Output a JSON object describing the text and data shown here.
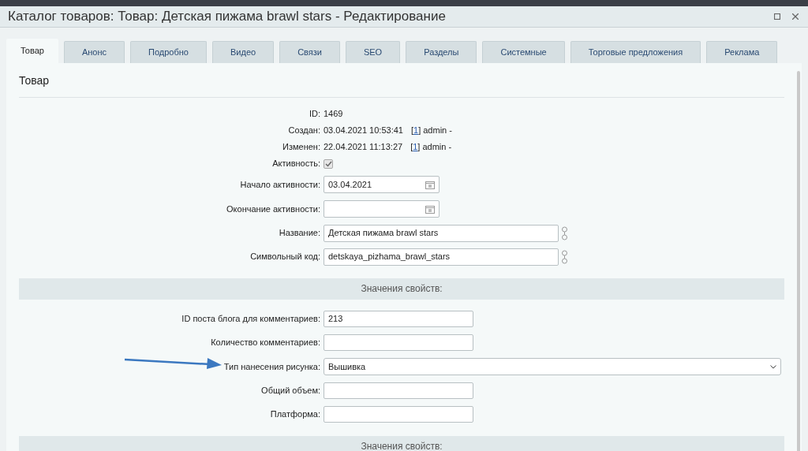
{
  "window": {
    "title": "Каталог товаров: Товар: Детская пижама brawl stars - Редактирование"
  },
  "tabs": [
    {
      "label": "Товар",
      "selected": true
    },
    {
      "label": "Анонс",
      "selected": false
    },
    {
      "label": "Подробно",
      "selected": false
    },
    {
      "label": "Видео",
      "selected": false
    },
    {
      "label": "Связи",
      "selected": false
    },
    {
      "label": "SEO",
      "selected": false
    },
    {
      "label": "Разделы",
      "selected": false
    },
    {
      "label": "Системные",
      "selected": false
    },
    {
      "label": "Торговые предложения",
      "selected": false
    },
    {
      "label": "Реклама",
      "selected": false
    }
  ],
  "section_title": "Товар",
  "rows": [
    {
      "kind": "text",
      "label": "ID:",
      "value": "1469"
    },
    {
      "kind": "text",
      "label": "Создан:",
      "value": "03.04.2021 10:53:41",
      "link_open": "[",
      "link": "1",
      "link_close": "] admin -"
    },
    {
      "kind": "text",
      "label": "Изменен:",
      "value": "22.04.2021 11:13:27",
      "link_open": "[",
      "link": "1",
      "link_close": "] admin -"
    },
    {
      "kind": "checkbox",
      "label": "Активность:",
      "checked": true
    },
    {
      "kind": "date",
      "label": "Начало активности:",
      "value": "03.04.2021"
    },
    {
      "kind": "date",
      "label": "Окончание активности:"
    },
    {
      "kind": "wide",
      "label": "Название:",
      "value": "Детская пижама brawl stars"
    },
    {
      "kind": "wide",
      "label": "Символьный код:",
      "value": "detskaya_pizhama_brawl_stars"
    },
    {
      "kind": "heading",
      "label": "Значения свойств:"
    },
    {
      "kind": "input",
      "label": "ID поста блога для комментариев:",
      "value": "213"
    },
    {
      "kind": "input",
      "label": "Количество комментариев:"
    },
    {
      "kind": "select",
      "label": "Тип нанесения рисунка:",
      "value": "Вышивка",
      "arrow": true
    },
    {
      "kind": "input",
      "label": "Общий объем:"
    },
    {
      "kind": "input",
      "label": "Платформа:"
    },
    {
      "kind": "heading",
      "label": "Значения свойств:"
    }
  ]
}
